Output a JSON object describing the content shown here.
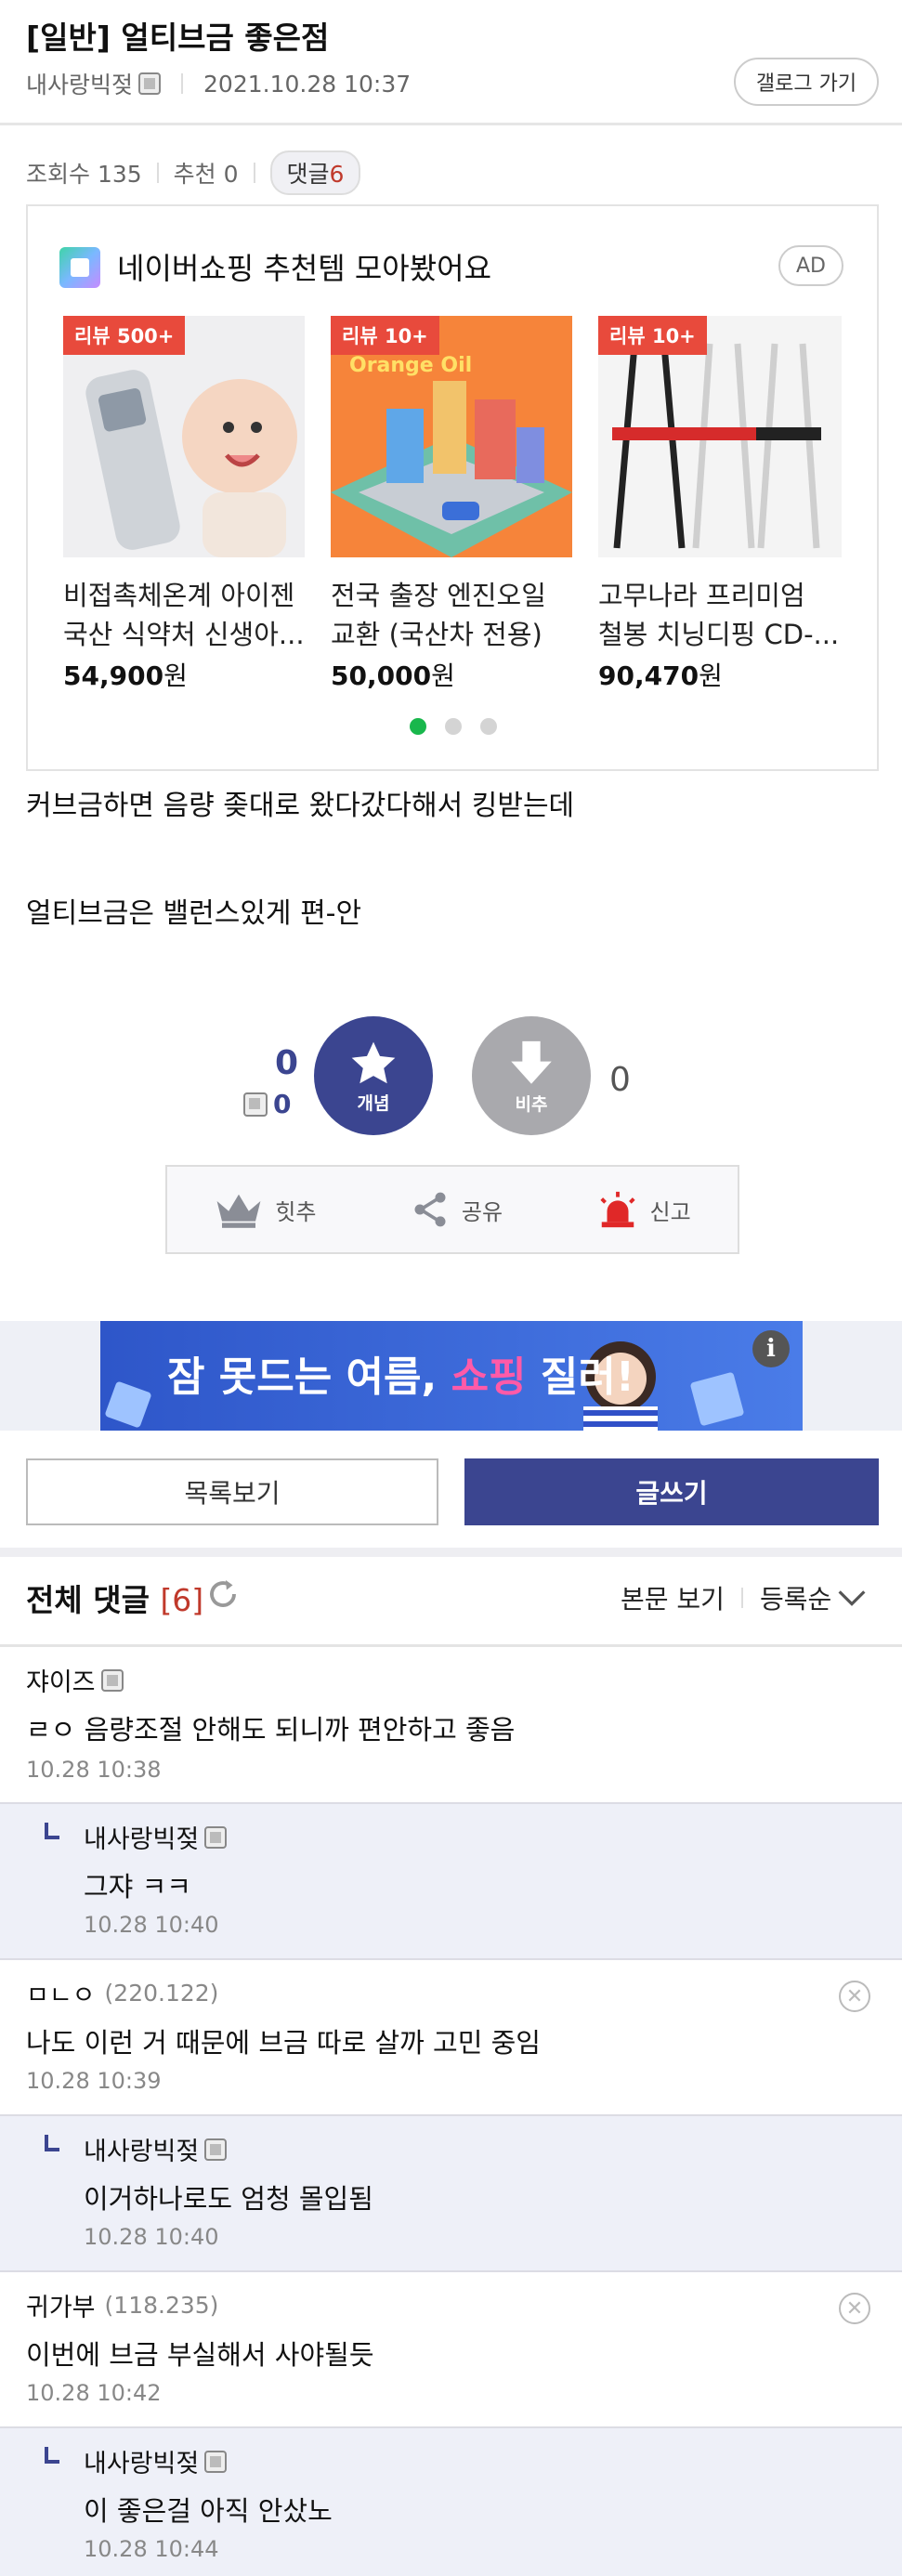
{
  "post": {
    "title": "[일반] 얼티브금 좋은점",
    "author": "내사랑빅젖",
    "date": "2021.10.28 10:37",
    "gallery_button": "갤로그 가기",
    "views_label": "조회수 135",
    "recommend_label": "추천 0",
    "comments_label": "댓글",
    "comments_count": "6"
  },
  "ad": {
    "title": "네이버쇼핑 추천템 모아봤어요",
    "tag": "AD",
    "products": [
      {
        "badge": "리뷰 500+",
        "name1": "비접촉체온계 아이젠",
        "name2": "국산 식약처 신생아...",
        "price": "54,900",
        "unit": "원"
      },
      {
        "badge": "리뷰 10+",
        "name1": "전국 출장 엔진오일",
        "name2": "교환 (국산차 전용)",
        "price": "50,000",
        "unit": "원"
      },
      {
        "badge": "리뷰 10+",
        "name1": "고무나라 프리미엄",
        "name2": "철봉 치닝디핑 CD-...",
        "price": "90,470",
        "unit": "원"
      }
    ]
  },
  "body": {
    "line1": "커브금하면 음량 좆대로 왔다갔다해서 킹받는데",
    "line2": "얼티브금은 밸런스있게 편-안"
  },
  "vote": {
    "up_count": "0",
    "up_fixed_count": "0",
    "up_label": "개념",
    "down_label": "비추",
    "down_count": "0"
  },
  "actions": {
    "hit": "힛추",
    "share": "공유",
    "report": "신고"
  },
  "banner": {
    "text_a": "잠 못드는 여름,",
    "text_b": "쇼핑",
    "text_c": "질러!",
    "info": "i"
  },
  "buttons": {
    "list": "목록보기",
    "write": "글쓰기"
  },
  "comments_header": {
    "title": "전체 댓글",
    "count": "[6]",
    "view_body": "본문 보기",
    "sort": "등록순"
  },
  "comments": [
    {
      "name": "쟈이즈",
      "ip": "",
      "text": "ㄹㅇ 음량조절 안해도 되니까 편안하고 좋음",
      "time": "10.28 10:38"
    },
    {
      "name": "내사랑빅젖",
      "ip": "",
      "text": "그쟈 ㅋㅋ",
      "time": "10.28 10:40"
    },
    {
      "name": "ㅁㄴㅇ",
      "ip": "(220.122)",
      "text": "나도 이런 거 때문에 브금 따로 살까 고민 중임",
      "time": "10.28 10:39"
    },
    {
      "name": "내사랑빅젖",
      "ip": "",
      "text": "이거하나로도 엄청 몰입됨",
      "time": "10.28 10:40"
    },
    {
      "name": "귀가부",
      "ip": "(118.235)",
      "text": "이번에 브금 부실해서 사야될듯",
      "time": "10.28 10:42"
    },
    {
      "name": "내사랑빅젖",
      "ip": "",
      "text": "이 좋은걸 아직 안샀노",
      "time": "10.28 10:44"
    }
  ]
}
